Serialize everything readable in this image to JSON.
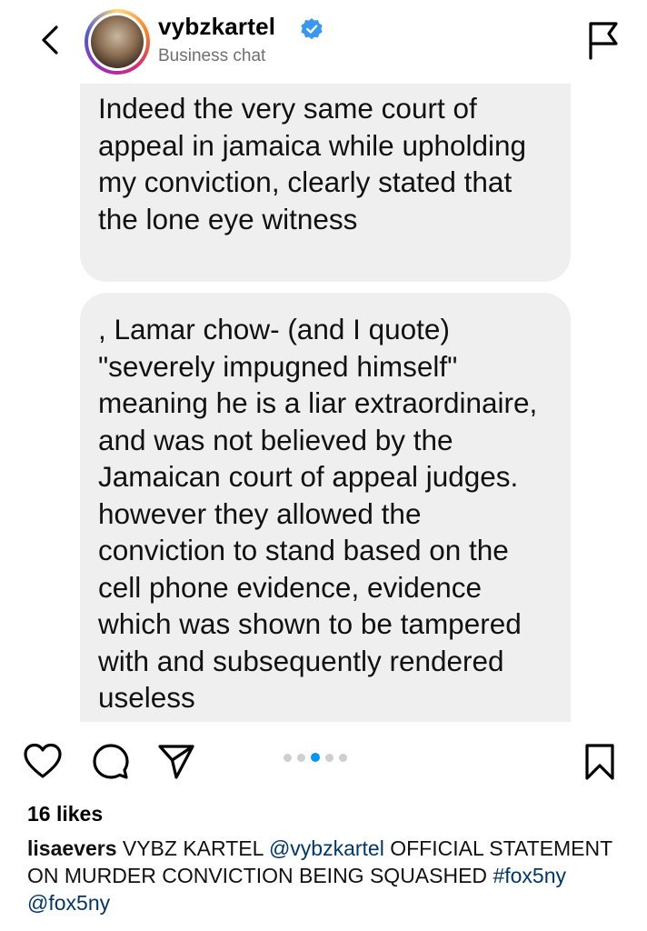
{
  "header": {
    "username": "vybzkartel",
    "subtitle": "Business chat",
    "verified": true,
    "icons": {
      "back": "chevron-left-icon",
      "report": "flag-icon",
      "badge": "verified-badge-icon"
    }
  },
  "messages": [
    {
      "text": "Indeed the very same court of appeal in jamaica while upholding my conviction, clearly stated that the lone eye witness"
    },
    {
      "text": ", Lamar chow- (and I quote) \"severely impugned himself\" meaning he is a liar extraordinaire, and was not believed by the Jamaican court of appeal judges.  however they allowed the conviction to stand based on the cell phone evidence,  evidence which was shown to be tampered with and subsequently rendered useless"
    }
  ],
  "carousel": {
    "total": 5,
    "active_index": 2
  },
  "actions": {
    "like": "heart-icon",
    "comment": "comment-icon",
    "share": "send-icon",
    "save": "bookmark-icon"
  },
  "post": {
    "likes": "16 likes",
    "caption_user": "lisaevers",
    "caption_text": "VYBZ KARTEL",
    "caption_mention1": "@vybzkartel",
    "caption_rest": "OFFICIAL STATEMENT ON MURDER CONVICTION BEING SQUASHED ",
    "caption_hashtag": "#fox5ny",
    "caption_mention2": "@fox5ny"
  },
  "colors": {
    "accent": "#0095f6",
    "verified": "#3897f0",
    "bubble": "#efefef",
    "link": "#00376b"
  }
}
